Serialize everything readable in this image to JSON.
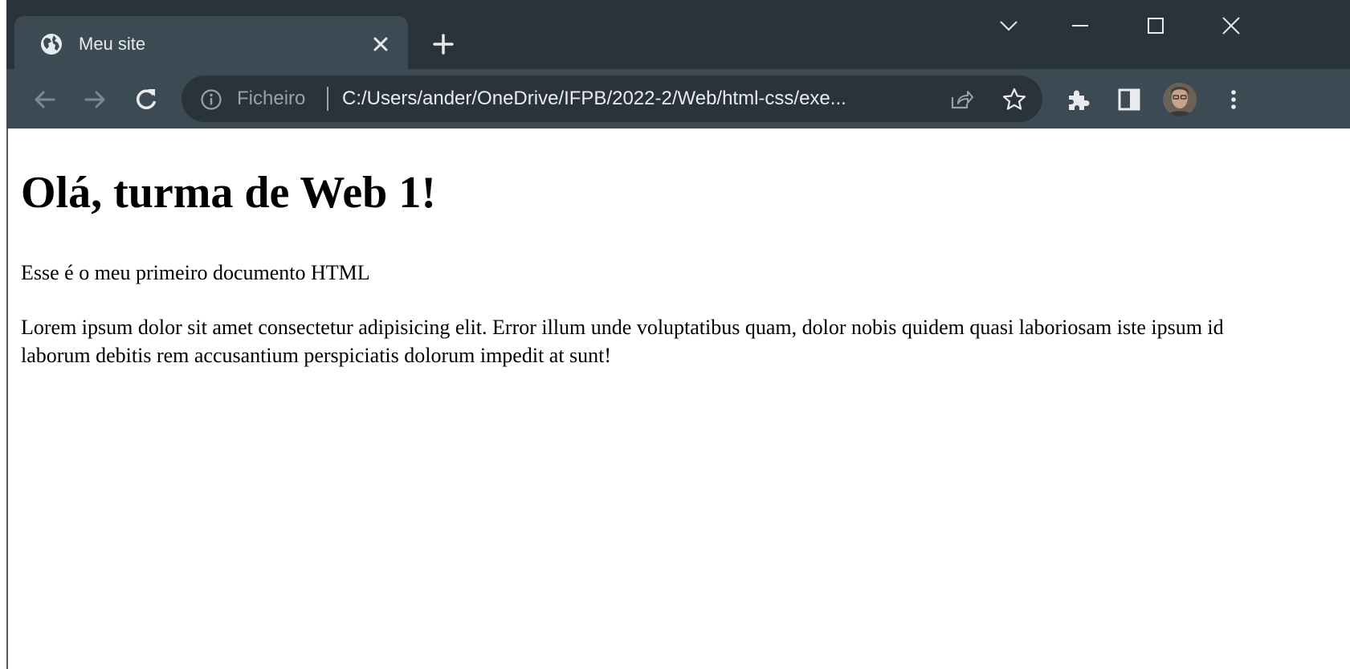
{
  "browser": {
    "tab": {
      "title": "Meu site",
      "icon": "globe-icon"
    },
    "toolbar": {
      "scheme_label": "Ficheiro",
      "url": "C:/Users/ander/OneDrive/IFPB/2022-2/Web/html-css/exe..."
    }
  },
  "page": {
    "heading": "Olá, turma de Web 1!",
    "paragraph_1": "Esse é o meu primeiro documento HTML",
    "paragraph_2": "Lorem ipsum dolor sit amet consectetur adipisicing elit. Error illum unde voluptatibus quam, dolor nobis quidem quasi laboriosam iste ipsum id laborum debitis rem accusantium perspiciatis dolorum impedit at sunt!"
  },
  "colors": {
    "tabstrip_bg": "#2b333a",
    "toolbar_bg": "#3c4a54",
    "omnibox_bg": "#2b333a",
    "icon_light": "#e8eaed",
    "icon_dim": "#9aa0a6"
  }
}
